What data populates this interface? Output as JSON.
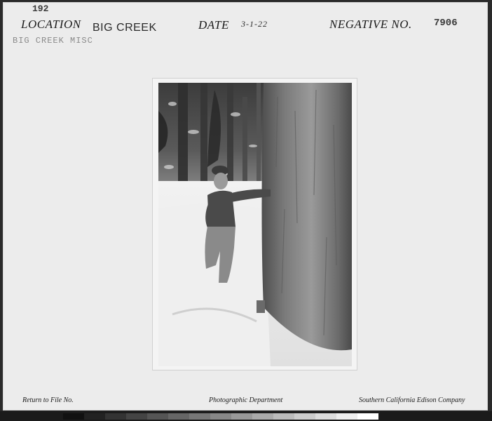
{
  "card": {
    "record_number": "192",
    "location_label": "LOCATION",
    "location_value": "BIG CREEK",
    "sub_stamp": "BIG CREEK MISC",
    "date_label": "DATE",
    "date_value": "3-1-22",
    "negative_label": "NEGATIVE NO.",
    "negative_value": "7906"
  },
  "footer": {
    "left": "Return to File No.",
    "center": "Photographic Department",
    "right": "Southern California Edison Company"
  },
  "colors": {
    "card": "#ececec",
    "ink": "#1a1a1a",
    "border": "#2a2a2a"
  }
}
